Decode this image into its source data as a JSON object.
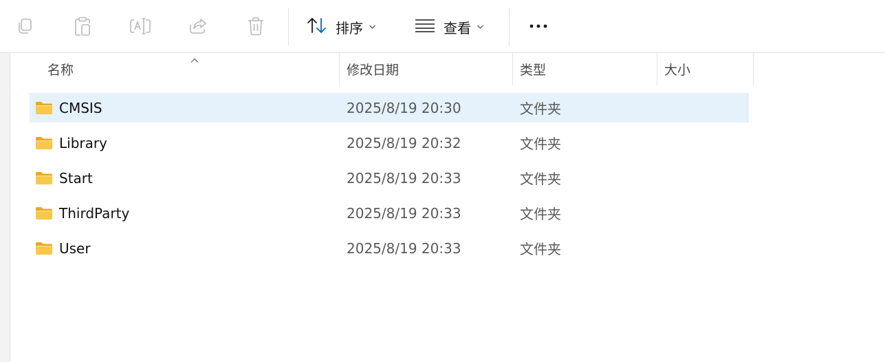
{
  "toolbar": {
    "buttons": [
      {
        "icon": "copy-icon",
        "name": "copy"
      },
      {
        "icon": "paste-icon",
        "name": "paste"
      },
      {
        "icon": "rename-icon",
        "name": "rename"
      },
      {
        "icon": "share-icon",
        "name": "share"
      },
      {
        "icon": "delete-icon",
        "name": "delete"
      }
    ],
    "sort_label": "排序",
    "view_label": "查看",
    "more_label": "•••"
  },
  "columns": {
    "name": "名称",
    "modified": "修改日期",
    "type": "类型",
    "size": "大小"
  },
  "files": [
    {
      "name": "CMSIS",
      "modified": "2025/8/19 20:30",
      "type": "文件夹",
      "size": "",
      "selected": true
    },
    {
      "name": "Library",
      "modified": "2025/8/19 20:32",
      "type": "文件夹",
      "size": "",
      "selected": false
    },
    {
      "name": "Start",
      "modified": "2025/8/19 20:33",
      "type": "文件夹",
      "size": "",
      "selected": false
    },
    {
      "name": "ThirdParty",
      "modified": "2025/8/19 20:33",
      "type": "文件夹",
      "size": "",
      "selected": false
    },
    {
      "name": "User",
      "modified": "2025/8/19 20:33",
      "type": "文件夹",
      "size": "",
      "selected": false
    }
  ],
  "colors": {
    "accent": "#0067c0",
    "selection": "#e5f1fb",
    "folder": "#f8c84a",
    "disabled_icon": "#b9b9b9"
  }
}
